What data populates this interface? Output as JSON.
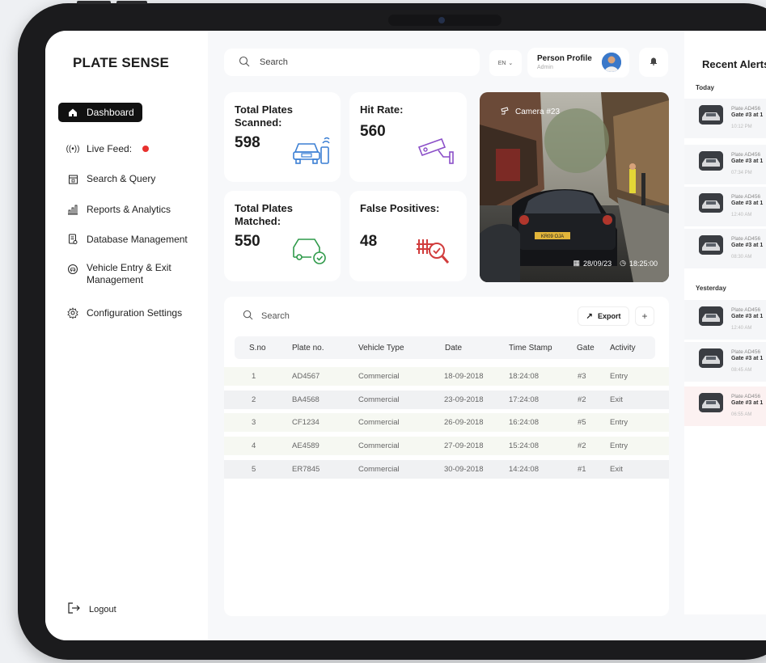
{
  "brand": "PLATE SENSE",
  "sidebar": {
    "items": [
      {
        "label": "Dashboard",
        "icon": "home-icon"
      },
      {
        "label": "Live Feed:",
        "icon": "broadcast-icon"
      },
      {
        "label": "Search & Query",
        "icon": "calendar-icon"
      },
      {
        "label": "Reports & Analytics",
        "icon": "chart-icon"
      },
      {
        "label": "Database Management",
        "icon": "database-icon"
      },
      {
        "label": "Vehicle Entry & Exit",
        "label2": "Management",
        "icon": "vehicle-icon"
      },
      {
        "label": "Configuration Settings",
        "icon": "gear-icon"
      }
    ],
    "logout": "Logout"
  },
  "topbar": {
    "search_placeholder": "Search",
    "lang": "EN",
    "profile_name": "Person Profile",
    "profile_role": "Admin"
  },
  "stats": {
    "scanned": {
      "title": "Total Plates Scanned:",
      "value": "598"
    },
    "hitrate": {
      "title": "Hit Rate:",
      "value": "560"
    },
    "matched": {
      "title": "Total Plates Matched:",
      "value": "550"
    },
    "false_pos": {
      "title": "False Positives:",
      "value": "48"
    }
  },
  "camera": {
    "label": "Camera #23",
    "date": "28/09/23",
    "time": "18:25:00",
    "plate": "KR09 OJA"
  },
  "table": {
    "search_placeholder": "Search",
    "export": "Export",
    "add": "+",
    "headers": [
      "S.no",
      "Plate no.",
      "Vehicle Type",
      "Date",
      "Time Stamp",
      "Gate",
      "Activity"
    ],
    "rows": [
      [
        "1",
        "AD4567",
        "Commercial",
        "18-09-2018",
        "18:24:08",
        "#3",
        "Entry"
      ],
      [
        "2",
        "BA4568",
        "Commercial",
        "23-09-2018",
        "17:24:08",
        "#2",
        "Exit"
      ],
      [
        "3",
        "CF1234",
        "Commercial",
        "26-09-2018",
        "16:24:08",
        "#5",
        "Entry"
      ],
      [
        "4",
        "AE4589",
        "Commercial",
        "27-09-2018",
        "15:24:08",
        "#2",
        "Entry"
      ],
      [
        "5",
        "ER7845",
        "Commercial",
        "30-09-2018",
        "14:24:08",
        "#1",
        "Exit"
      ]
    ]
  },
  "alerts": {
    "title": "Recent Alerts",
    "today_label": "Today",
    "yesterday_label": "Yesterday",
    "today": [
      {
        "line1": "Plate AD456",
        "line2": "Gate #3 at 1",
        "time": "10:12 PM"
      },
      {
        "line1": "Plate AD456",
        "line2": "Gate #3 at 1",
        "time": "07:34 PM"
      },
      {
        "line1": "Plate AD456",
        "line2": "Gate #3 at 1",
        "time": "12:40 AM"
      },
      {
        "line1": "Plate AD456",
        "line2": "Gate #3 at 1",
        "time": "08:30 AM"
      }
    ],
    "yesterday": [
      {
        "line1": "Plate AD456",
        "line2": "Gate #3 at 1",
        "time": "12:40 AM"
      },
      {
        "line1": "Plate AD456",
        "line2": "Gate #3 at 1",
        "time": "08:45 AM"
      },
      {
        "line1": "Plate AD456",
        "line2": "Gate #3 at 1",
        "time": "06:55 AM"
      }
    ]
  },
  "colors": {
    "accent_blue": "#3b7fd4",
    "accent_purple": "#8b4fc8",
    "accent_green": "#2f9a4a",
    "accent_red": "#d13c3c",
    "live_red": "#e8312e"
  }
}
